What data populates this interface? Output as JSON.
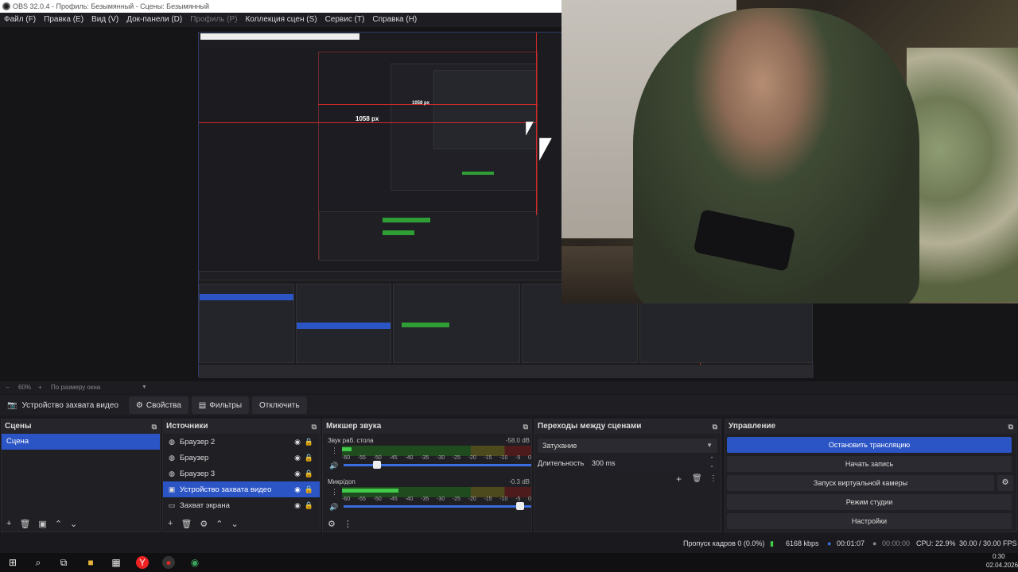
{
  "window": {
    "title": "OBS 32.0.4 - Профиль: Безымянный - Сцены: Безымянный"
  },
  "menu": [
    {
      "label": "Файл (F)",
      "disabled": false
    },
    {
      "label": "Правка (E)",
      "disabled": false
    },
    {
      "label": "Вид (V)",
      "disabled": false
    },
    {
      "label": "Док-панели (D)",
      "disabled": false
    },
    {
      "label": "Профиль (P)",
      "disabled": true
    },
    {
      "label": "Коллекция сцен (S)",
      "disabled": false
    },
    {
      "label": "Сервис (T)",
      "disabled": false
    },
    {
      "label": "Справка (H)",
      "disabled": false
    }
  ],
  "preview": {
    "measure_label_outer": "1058 px",
    "measure_label_inner": "1058 px"
  },
  "zoom": {
    "minus": "−",
    "value": "60%",
    "fit": "По размеру окна"
  },
  "source_toolbar": {
    "device": "Устройство захвата видео",
    "properties": "Свойства",
    "filters": "Фильтры",
    "deactivate": "Отключить"
  },
  "scenes": {
    "title": "Сцены",
    "items": [
      "Сцена"
    ]
  },
  "sources": {
    "title": "Источники",
    "items": [
      {
        "label": "Браузер 2",
        "icon": "globe-icon"
      },
      {
        "label": "Браузер",
        "icon": "globe-icon"
      },
      {
        "label": "Браузер 3",
        "icon": "globe-icon"
      },
      {
        "label": "Устройство захвата видео",
        "icon": "camera-icon"
      },
      {
        "label": "Захват экрана",
        "icon": "monitor-icon"
      }
    ]
  },
  "mixer": {
    "title": "Микшер звука",
    "tracks": [
      {
        "name": "Звук раб. стола",
        "db": "-58.0 dB",
        "level": 0.05,
        "volume": 0.2
      },
      {
        "name": "Микр/доп",
        "db": "-0.3 dB",
        "level": 0.3,
        "volume": 0.96
      }
    ],
    "scale": [
      "-60",
      "-55",
      "-50",
      "-45",
      "-40",
      "-35",
      "-30",
      "-25",
      "-20",
      "-15",
      "-10",
      "-5",
      "0"
    ]
  },
  "transitions": {
    "title": "Переходы между сценами",
    "selected": "Затухание",
    "duration_label": "Длительность",
    "duration_value": "300 ms"
  },
  "controls": {
    "title": "Управление",
    "stop_stream": "Остановить трансляцию",
    "start_record": "Начать запись",
    "virtual_cam": "Запуск виртуальной камеры",
    "studio_mode": "Режим студии",
    "settings": "Настройки"
  },
  "status": {
    "dropped": "Пропуск кадров 0 (0.0%)",
    "bitrate": "6168 kbps",
    "stream_time": "00:01:07",
    "rec_time": "00:00:00",
    "cpu": "CPU: 22.9%",
    "fps": "30.00 / 30.00 FPS"
  },
  "taskbar": {
    "time": "0:30",
    "date": "02.04.2026"
  },
  "colors": {
    "accent": "#2b54c5",
    "record": "#d12a2a",
    "meter_green": "#42c94a"
  }
}
